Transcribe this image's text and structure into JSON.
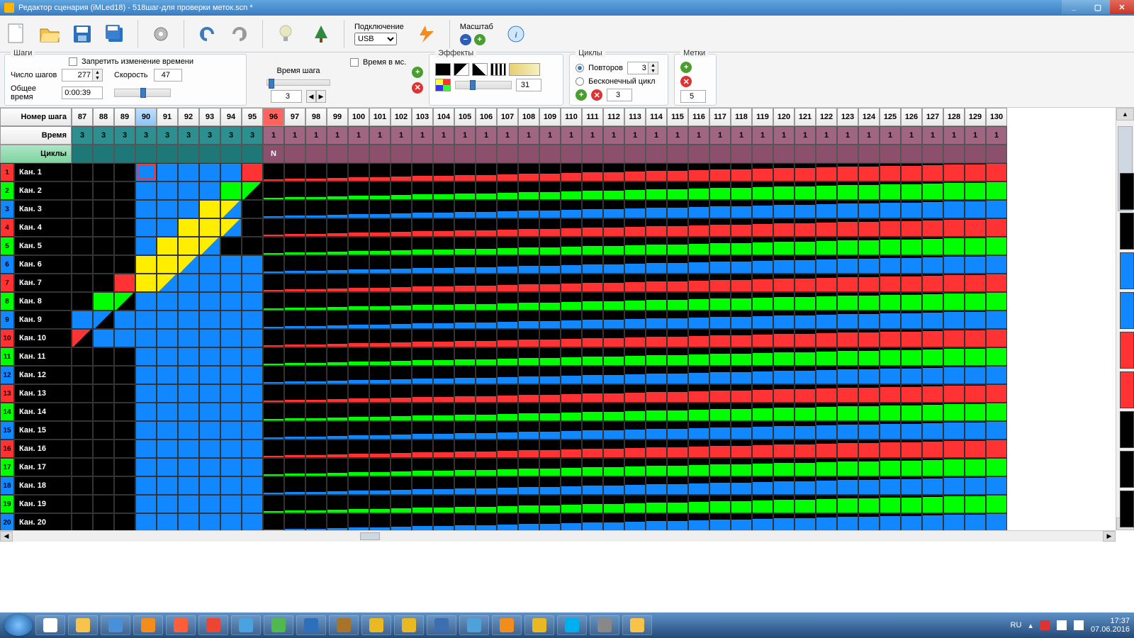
{
  "title": "Редактор сценария (iMLed18)  -  518шаг-для проверки меток.scn *",
  "toolbar": {
    "connect_label": "Подключение",
    "connect_value": "USB",
    "scale_label": "Масштаб"
  },
  "steps_panel": {
    "title": "Шаги",
    "lock_label": "Запретить изменение времени",
    "count_label": "Число шагов",
    "count_value": "277",
    "total_label": "Общее время",
    "total_value": "0:00:39",
    "speed_label": "Скорость",
    "speed_value": "47",
    "step_time_label": "Время шага",
    "time_ms_label": "Время в мс.",
    "step_time_value": "3"
  },
  "effects_panel": {
    "title": "Эффекты",
    "value": "31"
  },
  "cycles_panel": {
    "title": "Циклы",
    "repeats_label": "Повторов",
    "repeats_value": "3",
    "infinite_label": "Бесконечный цикл",
    "num": "3"
  },
  "marks_panel": {
    "title": "Метки",
    "num": "5"
  },
  "grid": {
    "row_headers": [
      "Номер шага",
      "Время",
      "Циклы"
    ],
    "first_step": 87,
    "step_count": 44,
    "sel_step": 90,
    "red_step": 96,
    "time_teal_count": 9,
    "time_teal_val": "3",
    "time_mauve_val": "1",
    "cycle_N_text": "N",
    "channels": [
      {
        "n": 1,
        "name": "Кан. 1",
        "c": "#f33",
        "type": "red"
      },
      {
        "n": 2,
        "name": "Кан. 2",
        "c": "#0f0",
        "type": "green"
      },
      {
        "n": 3,
        "name": "Кан. 3",
        "c": "#18f",
        "type": "blue"
      },
      {
        "n": 4,
        "name": "Кан. 4",
        "c": "#f33",
        "type": "red"
      },
      {
        "n": 5,
        "name": "Кан. 5",
        "c": "#0f0",
        "type": "green"
      },
      {
        "n": 6,
        "name": "Кан. 6",
        "c": "#18f",
        "type": "blue"
      },
      {
        "n": 7,
        "name": "Кан. 7",
        "c": "#f33",
        "type": "red"
      },
      {
        "n": 8,
        "name": "Кан. 8",
        "c": "#0f0",
        "type": "green"
      },
      {
        "n": 9,
        "name": "Кан. 9",
        "c": "#18f",
        "type": "blue"
      },
      {
        "n": 10,
        "name": "Кан. 10",
        "c": "#f33",
        "type": "red"
      },
      {
        "n": 11,
        "name": "Кан. 11",
        "c": "#0f0",
        "type": "green"
      },
      {
        "n": 12,
        "name": "Кан. 12",
        "c": "#18f",
        "type": "blue"
      },
      {
        "n": 13,
        "name": "Кан. 13",
        "c": "#f33",
        "type": "red"
      },
      {
        "n": 14,
        "name": "Кан. 14",
        "c": "#0f0",
        "type": "green"
      },
      {
        "n": 15,
        "name": "Кан. 15",
        "c": "#18f",
        "type": "blue"
      },
      {
        "n": 16,
        "name": "Кан. 16",
        "c": "#f33",
        "type": "red"
      },
      {
        "n": 17,
        "name": "Кан. 17",
        "c": "#0f0",
        "type": "green"
      },
      {
        "n": 18,
        "name": "Кан. 18",
        "c": "#18f",
        "type": "blue"
      },
      {
        "n": 19,
        "name": "Кан. 19",
        "c": "#0f0",
        "type": "green"
      },
      {
        "n": 20,
        "name": "Кан. 20",
        "c": "#18f",
        "type": "blue"
      }
    ],
    "pre96": {
      "96_fill": {
        "red": "#f33",
        "green": "#0f0",
        "blue": "#18f"
      },
      "blue_cols": {
        "1": [
          90,
          91,
          92,
          93,
          94
        ],
        "2": [
          90,
          91,
          92,
          93
        ],
        "3": [
          90,
          91,
          92
        ],
        "4": [
          90,
          91
        ],
        "5": [
          90
        ],
        "6": [
          90,
          91,
          92,
          93,
          94,
          95
        ],
        "7": [
          90,
          91,
          92,
          93,
          94,
          95
        ],
        "8": [
          90,
          91,
          92,
          93,
          94,
          95
        ],
        "9": [
          89,
          90,
          91,
          92,
          93,
          94,
          95
        ],
        "10": [
          88,
          89,
          90,
          91,
          92,
          93,
          94,
          95
        ],
        "11": [
          90,
          91,
          92,
          93,
          94,
          95
        ],
        "12": [
          90,
          91,
          92,
          93,
          94,
          95
        ],
        "13": [
          90,
          91,
          92,
          93,
          94,
          95
        ],
        "14": [
          90,
          91,
          92,
          93,
          94,
          95
        ],
        "15": [
          90,
          91,
          92,
          93,
          94,
          95
        ],
        "16": [
          90,
          91,
          92,
          93,
          94,
          95
        ],
        "17": [
          90,
          91,
          92,
          93,
          94,
          95
        ],
        "18": [
          90,
          91,
          92,
          93,
          94,
          95
        ],
        "19": [
          90,
          91,
          92,
          93,
          94,
          95
        ],
        "20": [
          90,
          91,
          92,
          93,
          94,
          95
        ]
      },
      "yellow": {
        "3": [
          93
        ],
        "4": [
          92,
          93
        ],
        "5": [
          91,
          92
        ],
        "6": [
          90,
          91
        ],
        "7": [
          90
        ]
      },
      "yel_diag": {
        "3": [
          94
        ],
        "4": [
          94
        ],
        "5": [
          93
        ],
        "6": [
          92
        ],
        "7": [
          91
        ]
      },
      "ch1_outline": 90,
      "ch1_red95": 95,
      "ch2_g94": 94,
      "ch2_gdiag95": 95,
      "ch7_r89": 89,
      "ch8_g88": 88,
      "ch8_gdiag89": 89,
      "ch9_bdiag88": 88,
      "ch9_b87": 87,
      "ch10_rdiag87": 87
    }
  },
  "right_palette": [
    "k",
    "k",
    "b",
    "b",
    "r",
    "r",
    "k",
    "k",
    "k"
  ],
  "taskbar": {
    "icons": [
      "#fff",
      "#f7c34a",
      "#4a90d9",
      "#f28c1d",
      "#ff5e3a",
      "#e43",
      "#4aa3df",
      "#4fb84f",
      "#2c6fbb",
      "#a8742a",
      "#e8b923",
      "#e8b923",
      "#3b6fb0",
      "#4fa2d9",
      "#f28c1d",
      "#e8b923",
      "#00aff0",
      "#888",
      "#f7c34a"
    ],
    "lang": "RU",
    "time": "17:37",
    "date": "07.06.2016"
  }
}
